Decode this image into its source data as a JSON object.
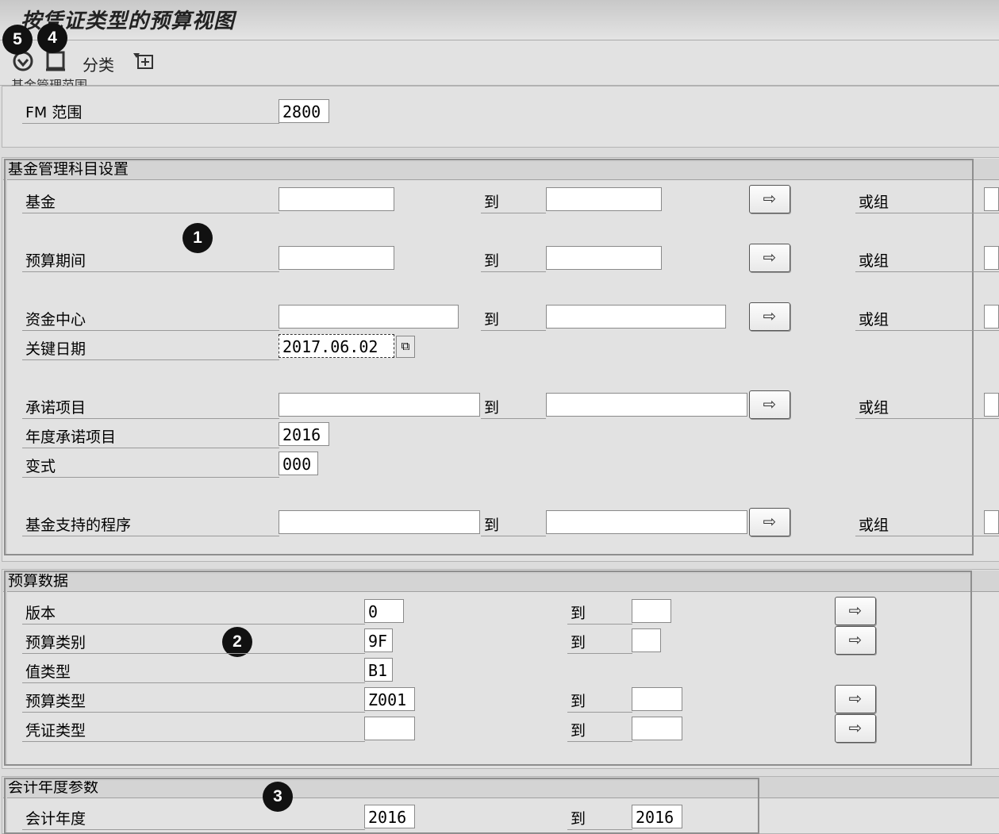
{
  "window": {
    "title": "按凭证类型的预算视图"
  },
  "toolbar": {
    "execute_icon": "execute-icon",
    "save_variant_icon": "save-variant-icon",
    "classify_label": "分类",
    "dynamic_selection_icon": "dynamic-selection-icon"
  },
  "badges": {
    "b1": "1",
    "b2": "2",
    "b3": "3",
    "b4": "4",
    "b5": "5"
  },
  "section_fm": {
    "cut_title": "基金管理范围",
    "fm_area_label": "FM 范围",
    "fm_area_value": "2800"
  },
  "section_fund": {
    "title": "基金管理科目设置",
    "to_label": "到",
    "or_group_label": "或组",
    "fund_label": "基金",
    "budget_period_label": "预算期间",
    "funds_center_label": "资金中心",
    "key_date_label": "关键日期",
    "key_date_value": "2017.06.02",
    "commitment_item_label": "承诺项目",
    "fiscal_year_commit_label": "年度承诺项目",
    "fiscal_year_commit_value": "2016",
    "variant_label": "变式",
    "variant_value": "000",
    "funded_program_label": "基金支持的程序"
  },
  "section_budget": {
    "title": "预算数据",
    "to_label": "到",
    "version_label": "版本",
    "version_value": "0",
    "budget_category_label": "预算类别",
    "budget_category_value": "9F",
    "value_type_label": "值类型",
    "value_type_value": "B1",
    "budget_type_label": "预算类型",
    "budget_type_value": "Z001",
    "document_type_label": "凭证类型"
  },
  "section_fy": {
    "title": "会计年度参数",
    "to_label": "到",
    "fiscal_year_label": "会计年度",
    "fiscal_year_from": "2016",
    "fiscal_year_to": "2016"
  },
  "icons": {
    "multiple_selection": "arrow-right-icon",
    "calendar": "calendar-icon"
  }
}
